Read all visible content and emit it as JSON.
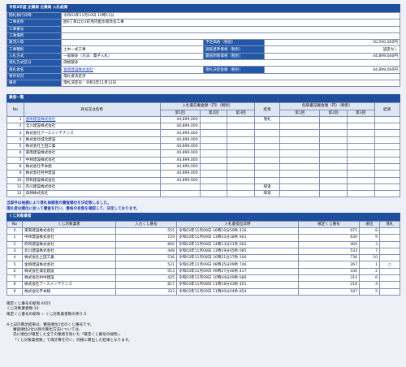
{
  "header": {
    "title": "令和3年度 企業局 企業局 入札結果"
  },
  "info_rows": [
    {
      "label": "開札執行日時",
      "value": "令和03年11月10日 10時11分"
    },
    {
      "label": "工事名称",
      "value": "屋6丁目ほか2町地内配水管改良工事"
    },
    {
      "label": "工事番号",
      "value": ""
    },
    {
      "label": "工事場所",
      "value": ""
    }
  ],
  "info_pairs": [
    {
      "l1": "路河川等",
      "v1": "",
      "l2": "予定価格（税別）",
      "v2": "50,590,000円"
    },
    {
      "l1": "工事種別",
      "v1": "土木一式工事",
      "l2": "調査基準価格（税別）",
      "v2": "設定なし"
    },
    {
      "l1": "入札方式",
      "v1": "一般競争（方法：電子入札）",
      "l2": "最低制限価格（税別）",
      "v2": "44,899,000円"
    },
    {
      "l1": "落札方式区分",
      "v1": "価格競争",
      "l2": "",
      "v2": ""
    },
    {
      "l1": "落札者名",
      "v1": "金剛建設株式会社",
      "l2": "落札決定金額（税別）",
      "v2": "44,899,000円",
      "link": true
    }
  ],
  "info_tail": [
    {
      "label": "事件状況",
      "value": "落札者決定済"
    },
    {
      "label": "備考",
      "value": "落札決定日：令和3年11月12日"
    }
  ],
  "bidders": {
    "title": "業者一覧",
    "h_no": "No",
    "h_name": "商号又は名称",
    "h_bid": "入札書記載金額（円）（税別）",
    "h_result": "結果",
    "h_chk": "危険書記載金額（円）（税別）",
    "h_remark": "結果",
    "round1": "第1回",
    "round2": "第2回",
    "round3": "第3回",
    "rows": [
      {
        "no": "1",
        "name": "金剛建設株式会社",
        "amount": "44,899,000",
        "result": "落札",
        "link": true
      },
      {
        "no": "2",
        "name": "北川建設株式会社",
        "amount": "44,899,000",
        "result": ""
      },
      {
        "no": "3",
        "name": "株式会社アースメンテナンス",
        "amount": "44,899,000",
        "result": ""
      },
      {
        "no": "4",
        "name": "株式会社城北建設",
        "amount": "44,899,000",
        "result": ""
      },
      {
        "no": "5",
        "name": "株式会社土田工業",
        "amount": "44,899,000",
        "result": ""
      },
      {
        "no": "6",
        "name": "東南建設株式会社",
        "amount": "44,899,000",
        "result": ""
      },
      {
        "no": "7",
        "name": "中林建設株式会社",
        "amount": "44,899,000",
        "result": ""
      },
      {
        "no": "8",
        "name": "株式会社平本組",
        "amount": "44,899,000",
        "result": ""
      },
      {
        "no": "9",
        "name": "株式会社村中建設",
        "amount": "44,899,000",
        "result": ""
      },
      {
        "no": "10",
        "name": "府和建設株式会社",
        "amount": "44,899,000",
        "result": ""
      },
      {
        "no": "11",
        "name": "内川建設株式会社",
        "amount": "",
        "result": "辞退"
      },
      {
        "no": "12",
        "name": "高林株式会社",
        "amount": "",
        "result": "辞退"
      }
    ]
  },
  "notice": {
    "line1": "当案件は抽選により落札候補者の審査順位を決定致しました。",
    "line2": "落札者は順位に従って審査を行い、資格の有無を確認して、決定しております。"
  },
  "lottery": {
    "title": "くじ対象業者",
    "h_no": "No",
    "h_name": "くじ対象業者",
    "h_input": "入力くじ番号",
    "h_time": "入札書提出日時",
    "h_conf": "確定くじ番号",
    "h_rank": "順位",
    "h_win": "落札",
    "rows": [
      {
        "no": "0",
        "name": "東南建設株式会社",
        "num": "555",
        "time": "令和03年11月08日 16時10分59秒 416",
        "conf": "971",
        "rank": "8",
        "win": ""
      },
      {
        "no": "1",
        "name": "中林建設株式会社",
        "num": "729",
        "time": "令和03年11月09日 13時33分18秒 901",
        "conf": "630",
        "rank": "9",
        "win": ""
      },
      {
        "no": "2",
        "name": "府和建設株式会社",
        "num": "806",
        "time": "令和03年11月08日 14時13分51秒 663",
        "conf": "469",
        "rank": "3",
        "win": ""
      },
      {
        "no": "3",
        "name": "北川建設株式会社",
        "num": "448",
        "time": "令和03年11月08日 13時19分05秒 085",
        "conf": "533",
        "rank": "7",
        "win": ""
      },
      {
        "no": "4",
        "name": "株式会社土田工業",
        "num": "536",
        "time": "令和03年11月08日 16時21分17秒 200",
        "conf": "736",
        "rank": "10",
        "win": ""
      },
      {
        "no": "5",
        "name": "金剛建設株式会社",
        "num": "521",
        "time": "令和03年11月09日 08時35分09秒 746",
        "conf": "267",
        "rank": "1",
        "win": "○"
      },
      {
        "no": "6",
        "name": "株式会社城北建設",
        "num": "913",
        "time": "令和03年11月09日 09時27分46秒 417",
        "conf": "330",
        "rank": "2",
        "win": ""
      },
      {
        "no": "7",
        "name": "株式会社村中建設",
        "num": "425",
        "time": "令和03年11月09日 10時44分49秒 689",
        "conf": "314",
        "rank": "6",
        "win": ""
      },
      {
        "no": "8",
        "name": "株式会社アースメンテナンス",
        "num": "817",
        "time": "令和03年11月08日 11時18分43秒 401",
        "conf": "218",
        "rank": "4",
        "win": ""
      },
      {
        "no": "9",
        "name": "株式会社平本組",
        "num": "333",
        "time": "令和03年11月09日 11時00分04秒 854",
        "conf": "187",
        "rank": "5",
        "win": ""
      }
    ]
  },
  "footer": {
    "l1": "確定くじ番号の総和:4655",
    "l2": "くじ対象業者数:10",
    "l3": "確定くじ番号の総和 ÷ くじ対象業者数の余り:5"
  },
  "notes": {
    "n1": "※上記の算出結果は、審査順位1位のくじ番号です。",
    "n2": "審査順位2位以降の算出方法については、",
    "n3": "先に順位が確定した全ての業者を除いた「確定くじ番号の総和」、",
    "n4": "「くじ対象業者数」で再計算を行い、同様に算出した結果となります。"
  }
}
